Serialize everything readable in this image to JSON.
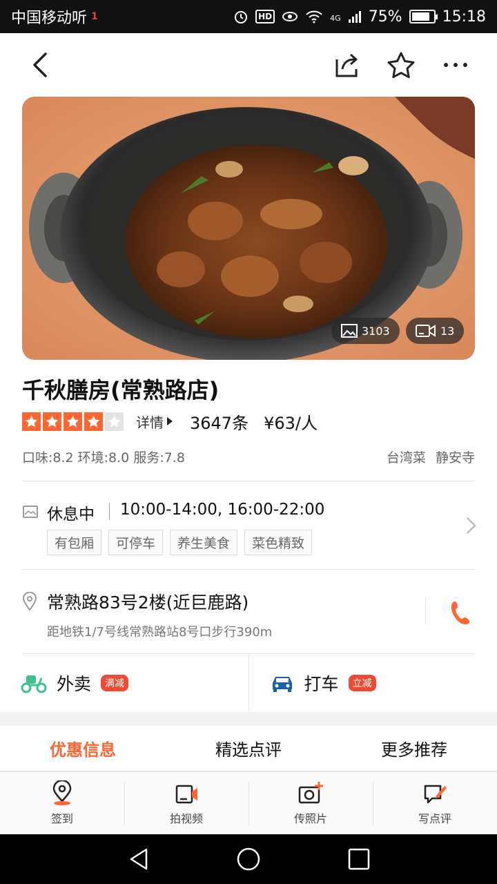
{
  "status_bar": {
    "carrier": "中国移动听",
    "carrier_badge": "1",
    "network": "4G",
    "battery": "75%",
    "time": "15:18"
  },
  "nav": {
    "back_icon": "chevron-left-icon",
    "share_icon": "share-icon",
    "favorite_icon": "star-outline-icon",
    "more_icon": "more-dots-icon"
  },
  "hero": {
    "photo_count": "3103",
    "video_count": "13"
  },
  "shop": {
    "name": "千秋膳房(常熟路店)",
    "rating_stars": 4,
    "rating_max": 5,
    "details_label": "详情",
    "review_count": "3647条",
    "price": "¥63/人",
    "scores": "口味:8.2 环境:8.0 服务:7.8",
    "cuisine": "台湾菜",
    "area": "静安寺"
  },
  "hours": {
    "status": "休息中",
    "time": "10:00-14:00, 16:00-22:00",
    "tags": [
      "有包厢",
      "可停车",
      "养生美食",
      "菜色精致"
    ]
  },
  "address": {
    "text": "常熟路83号2楼(近巨鹿路)",
    "transit": "距地铁1/7号线常熟路站8号口步行390m"
  },
  "services": {
    "delivery_label": "外卖",
    "delivery_badge": "满减",
    "taxi_label": "打车",
    "taxi_badge": "立减"
  },
  "tabs": [
    {
      "label": "优惠信息",
      "active": true
    },
    {
      "label": "精选点评",
      "active": false
    },
    {
      "label": "更多推荐",
      "active": false
    }
  ],
  "actions": [
    {
      "label": "签到",
      "icon": "checkin-pin-icon"
    },
    {
      "label": "拍视频",
      "icon": "video-camera-icon"
    },
    {
      "label": "传照片",
      "icon": "upload-photo-icon"
    },
    {
      "label": "写点评",
      "icon": "write-review-icon"
    }
  ],
  "colors": {
    "accent": "#ff6633",
    "badge_red": "#f04a30",
    "delivery_green": "#3fc28d",
    "taxi_blue": "#1e5fa8"
  }
}
